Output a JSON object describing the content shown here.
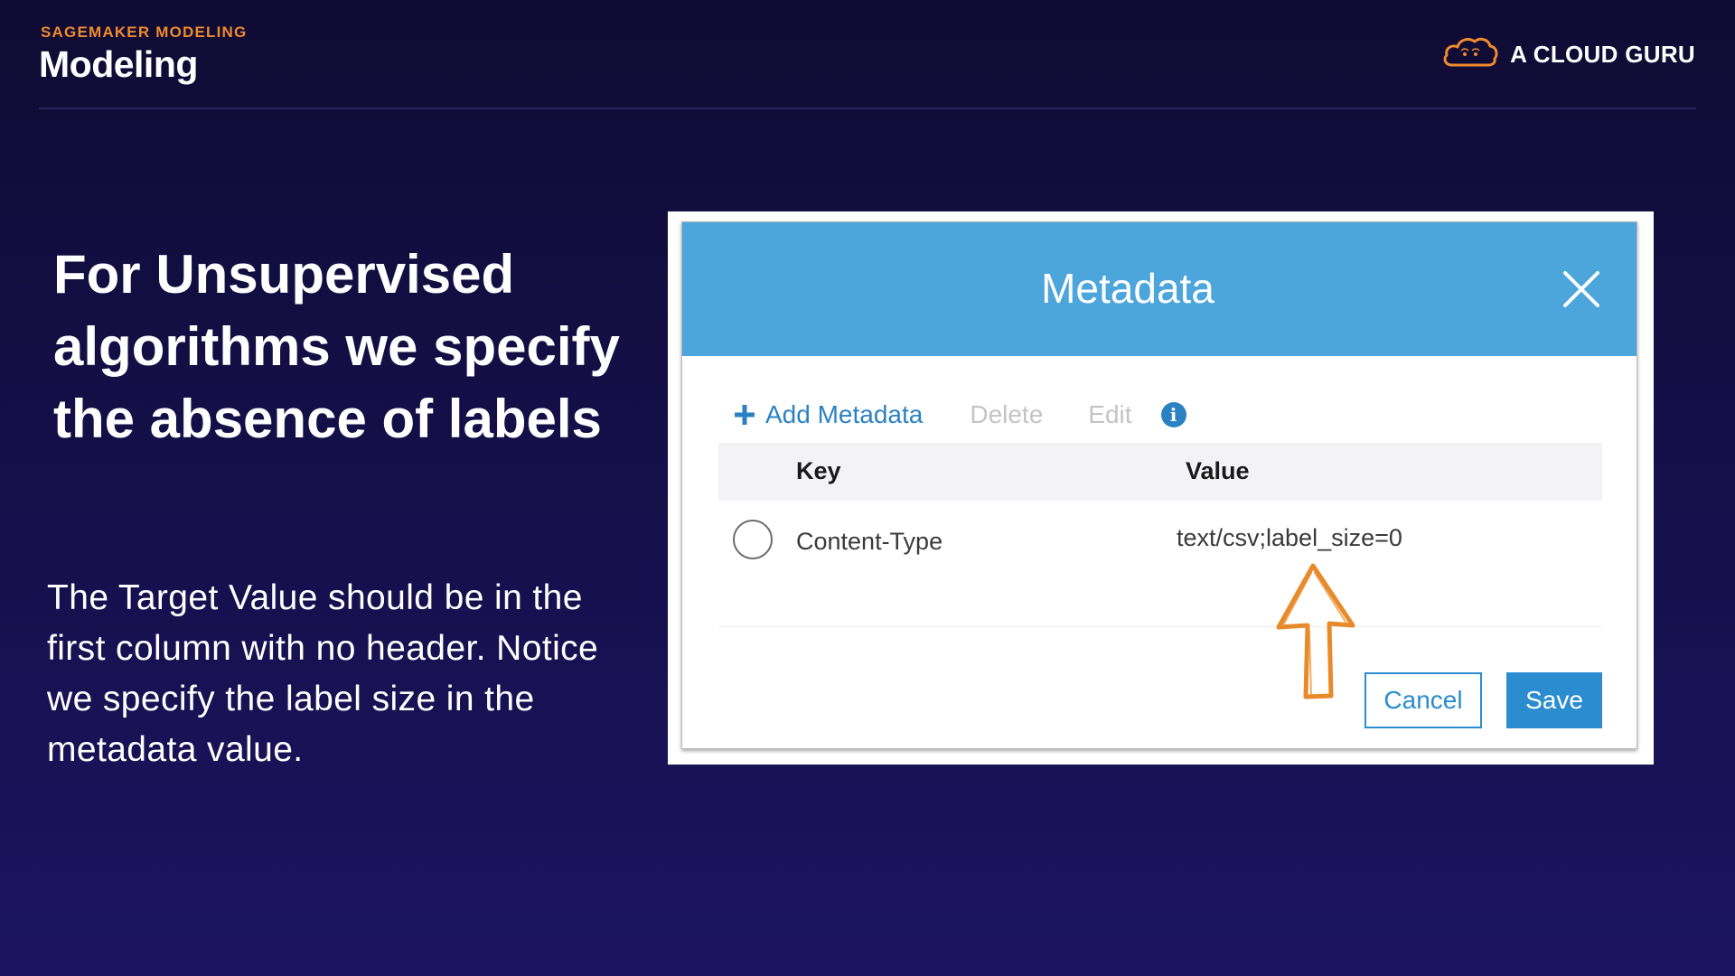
{
  "header": {
    "eyebrow": "SAGEMAKER MODELING",
    "title": "Modeling",
    "brand_name": "A CLOUD GURU",
    "brand_color": "#ef8a2e"
  },
  "slide": {
    "headline": "For Unsupervised algorithms we specify the absence of labels",
    "body": "The Target Value should be in the first column with no header. Notice we specify the label size in the metadata value."
  },
  "modal": {
    "title": "Metadata",
    "header_color": "#4ca5db",
    "toolbar": {
      "add_label": "Add Metadata",
      "delete_label": "Delete",
      "edit_label": "Edit",
      "info_icon": "info-icon"
    },
    "table": {
      "columns": [
        "Key",
        "Value"
      ],
      "rows": [
        {
          "key": "Content-Type",
          "value": "text/csv;label_size=0"
        }
      ]
    },
    "buttons": {
      "cancel_label": "Cancel",
      "save_label": "Save"
    },
    "accent_color": "#2b8cd0",
    "annotation_color": "#e88a2a"
  }
}
